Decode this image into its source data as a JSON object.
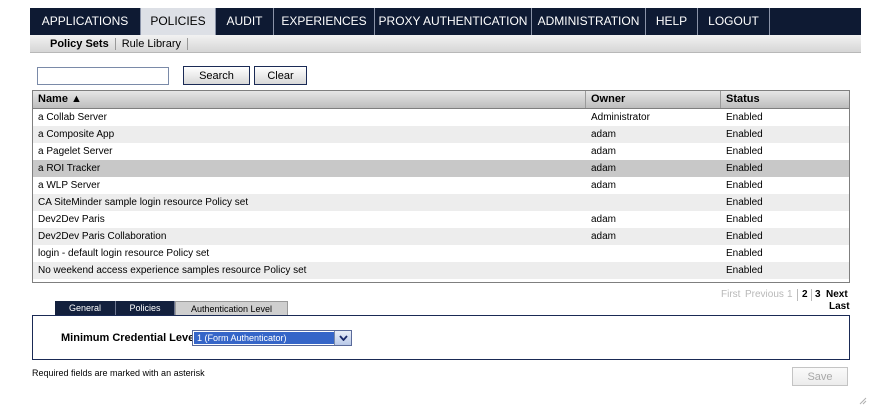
{
  "topnav": {
    "items": [
      {
        "label": "APPLICATIONS",
        "active": false
      },
      {
        "label": "POLICIES",
        "active": true
      },
      {
        "label": "AUDIT",
        "active": false
      },
      {
        "label": "EXPERIENCES",
        "active": false
      },
      {
        "label": "PROXY AUTHENTICATION",
        "active": false
      },
      {
        "label": "ADMINISTRATION",
        "active": false
      },
      {
        "label": "HELP",
        "active": false
      },
      {
        "label": "LOGOUT",
        "active": false
      }
    ]
  },
  "subnav": {
    "items": [
      {
        "label": "Policy Sets",
        "active": true
      },
      {
        "label": "Rule Library",
        "active": false
      }
    ]
  },
  "search": {
    "value": "",
    "placeholder": "",
    "search_label": "Search",
    "clear_label": "Clear"
  },
  "table": {
    "columns": {
      "name": "Name ▲",
      "owner": "Owner",
      "status": "Status"
    },
    "rows": [
      {
        "name": "a Collab Server",
        "owner": "Administrator",
        "status": "Enabled"
      },
      {
        "name": "a Composite App",
        "owner": "adam",
        "status": "Enabled"
      },
      {
        "name": "a Pagelet Server",
        "owner": "adam",
        "status": "Enabled"
      },
      {
        "name": "a ROI Tracker",
        "owner": "adam",
        "status": "Enabled"
      },
      {
        "name": "a WLP Server",
        "owner": "adam",
        "status": "Enabled"
      },
      {
        "name": "CA SiteMinder sample login resource Policy set",
        "owner": "",
        "status": "Enabled"
      },
      {
        "name": "Dev2Dev Paris",
        "owner": "adam",
        "status": "Enabled"
      },
      {
        "name": "Dev2Dev Paris Collaboration",
        "owner": "adam",
        "status": "Enabled"
      },
      {
        "name": "login - default login resource Policy set",
        "owner": "",
        "status": "Enabled"
      },
      {
        "name": "No weekend access experience samples resource Policy set",
        "owner": "",
        "status": "Enabled"
      }
    ],
    "selected_row": "a ROI Tracker"
  },
  "pager": {
    "first": "First",
    "previous": "Previous",
    "page1": "1",
    "page2": "2",
    "page3": "3",
    "next": "Next",
    "last": "Last"
  },
  "detail_tabs": [
    {
      "label": "General",
      "active": false
    },
    {
      "label": "Policies",
      "active": false
    },
    {
      "label": "Authentication Level",
      "active": true
    }
  ],
  "credential": {
    "label": "Minimum Credential Level:",
    "value": "1 (Form Authenticator)"
  },
  "footer": {
    "required_note": "Required fields are marked with an asterisk",
    "save_label": "Save"
  },
  "colors": {
    "nav_bg": "#0e1a33",
    "nav_active_bg": "#dde0e6",
    "select_highlight": "#3565c8",
    "row_alt": "#ededed",
    "row_selected": "#c8c8c8"
  }
}
